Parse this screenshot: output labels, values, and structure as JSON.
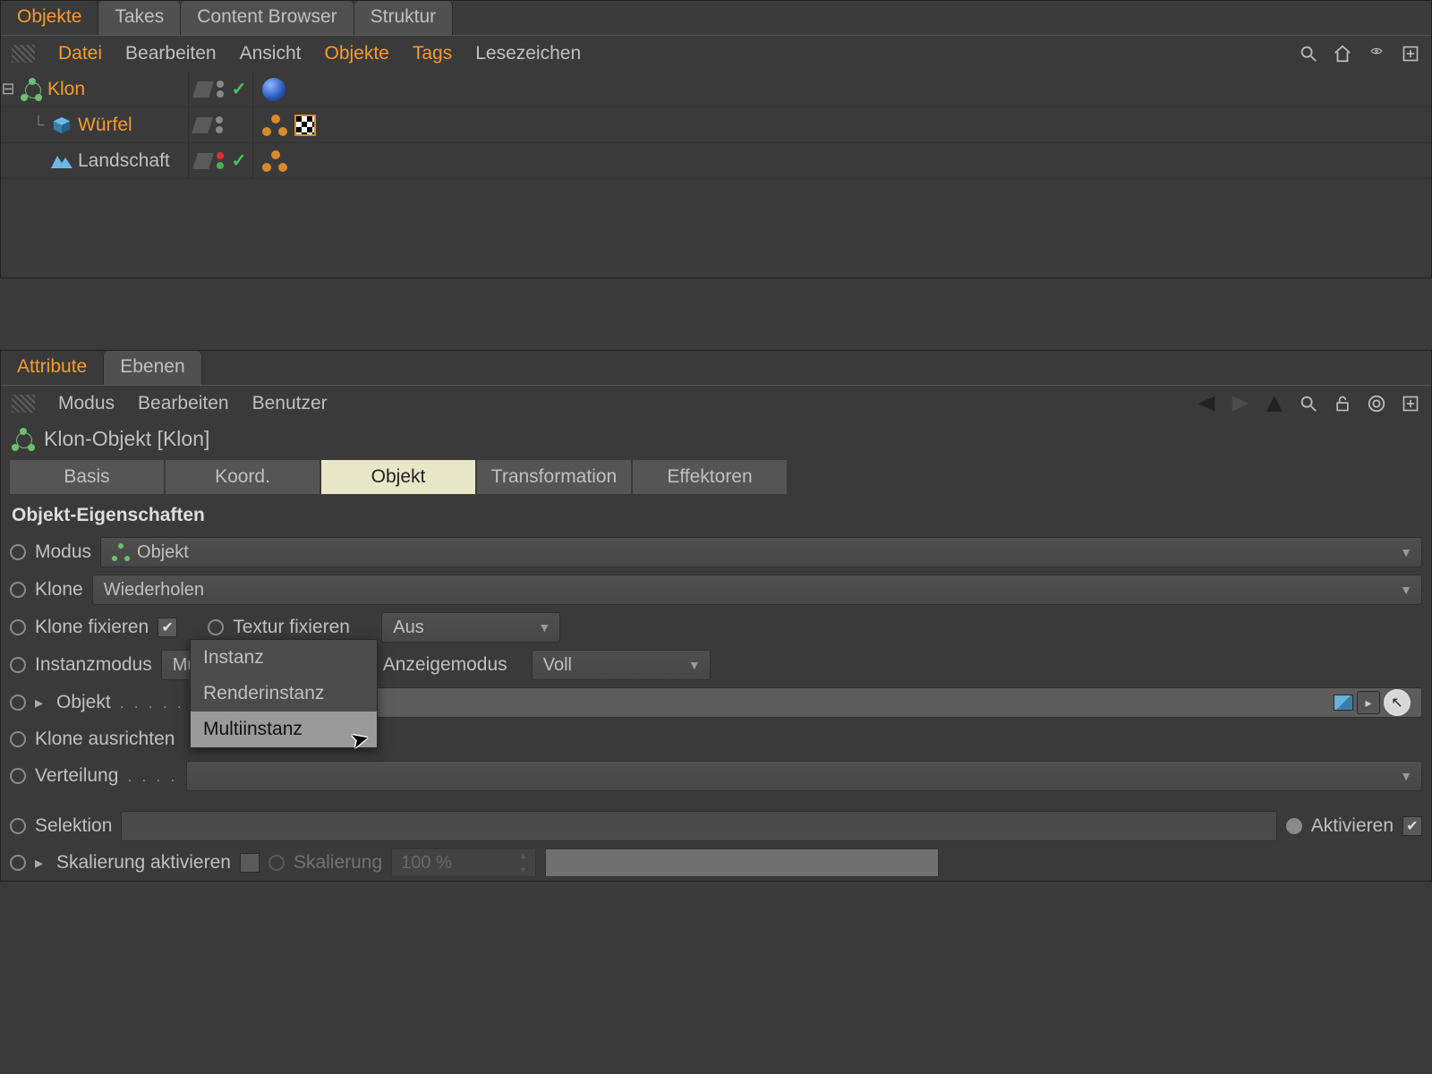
{
  "topTabs": {
    "objekte": "Objekte",
    "takes": "Takes",
    "content": "Content Browser",
    "struktur": "Struktur"
  },
  "topMenu": {
    "datei": "Datei",
    "bearbeiten": "Bearbeiten",
    "ansicht": "Ansicht",
    "objekte": "Objekte",
    "tags": "Tags",
    "lesezeichen": "Lesezeichen"
  },
  "tree": {
    "items": [
      {
        "label": "Klon",
        "highlighted": true,
        "indent": 0,
        "icon": "cloner"
      },
      {
        "label": "Würfel",
        "highlighted": true,
        "indent": 1,
        "icon": "cube"
      },
      {
        "label": "Landschaft",
        "highlighted": false,
        "indent": 1,
        "icon": "landscape"
      }
    ]
  },
  "attrTabs": {
    "attribute": "Attribute",
    "ebenen": "Ebenen"
  },
  "attrMenu": {
    "modus": "Modus",
    "bearbeiten": "Bearbeiten",
    "benutzer": "Benutzer"
  },
  "header": "Klon-Objekt [Klon]",
  "propTabs": {
    "basis": "Basis",
    "koord": "Koord.",
    "objekt": "Objekt",
    "transformation": "Transformation",
    "effektoren": "Effektoren"
  },
  "section": "Objekt-Eigenschaften",
  "props": {
    "modus": {
      "label": "Modus",
      "value": "Objekt"
    },
    "klone": {
      "label": "Klone",
      "value": "Wiederholen"
    },
    "kloneFix": {
      "label": "Klone fixieren"
    },
    "texturFix": {
      "label": "Textur fixieren",
      "value": "Aus"
    },
    "instanz": {
      "label": "Instanzmodus",
      "value": "Multiinstanz"
    },
    "anzeige": {
      "label": "Anzeigemodus",
      "value": "Voll"
    },
    "objekt": {
      "label": "Objekt"
    },
    "ausrichten": {
      "label": "Klone ausrichten"
    },
    "verteilung": {
      "label": "Verteilung"
    },
    "selektion": {
      "label": "Selektion"
    },
    "aktivieren": {
      "label": "Aktivieren"
    },
    "skalAkt": {
      "label": "Skalierung aktivieren"
    },
    "skalierung": {
      "label": "Skalierung",
      "value": "100 %"
    }
  },
  "dropdown": {
    "options": [
      "Instanz",
      "Renderinstanz",
      "Multiinstanz"
    ],
    "selected": "Multiinstanz"
  }
}
